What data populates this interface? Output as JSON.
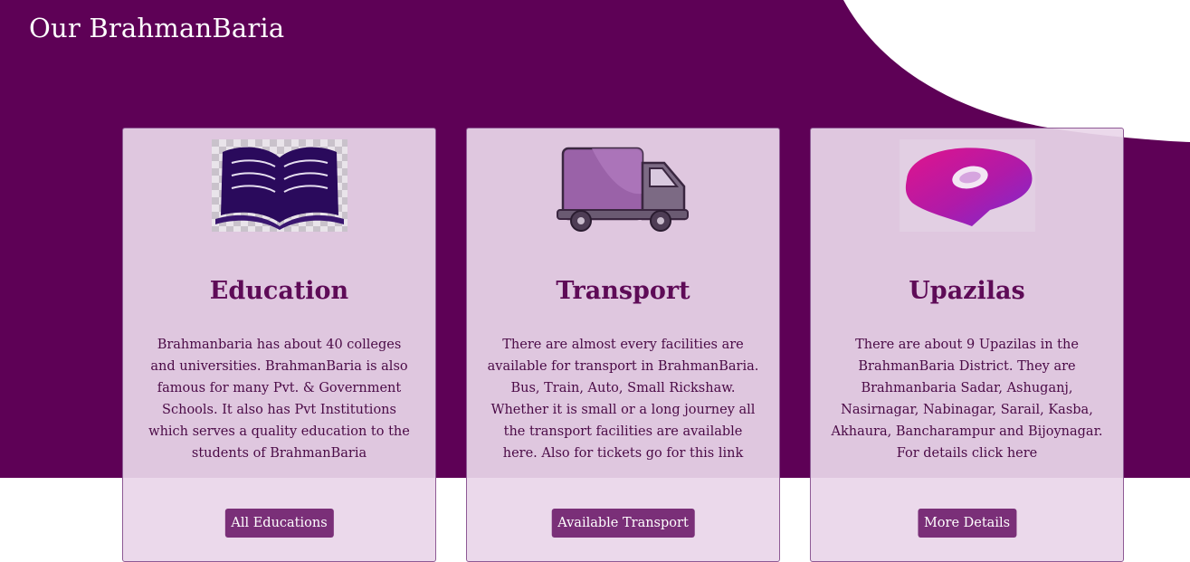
{
  "site": {
    "title": "Our BrahmanBaria"
  },
  "theme": {
    "primary": "#5e0156",
    "card_bg": "#ead6ea",
    "button": "#7a2f78"
  },
  "cards": [
    {
      "icon": "open-book-icon",
      "title": "Education",
      "text": "Brahmanbaria has about 40 colleges and universities. BrahmanBaria is also famous for many Pvt. & Government Schools. It also has Pvt Institutions which serves a quality education to the students of BrahmanBaria",
      "button": "All Educations"
    },
    {
      "icon": "delivery-truck-icon",
      "title": "Transport",
      "text": "There are almost every facilities are available for transport in BrahmanBaria. Bus, Train, Auto, Small Rickshaw. Whether it is small or a long journey all the transport facilities are available here. Also for tickets go for this link",
      "button": "Available Transport"
    },
    {
      "icon": "map-pin-icon",
      "title": "Upazilas",
      "text": "There are about 9 Upazilas in the BrahmanBaria District. They are Brahmanbaria Sadar, Ashuganj, Nasirnagar, Nabinagar, Sarail, Kasba, Akhaura, Bancharampur and Bijoynagar. For details click here",
      "button": "More Details"
    }
  ]
}
